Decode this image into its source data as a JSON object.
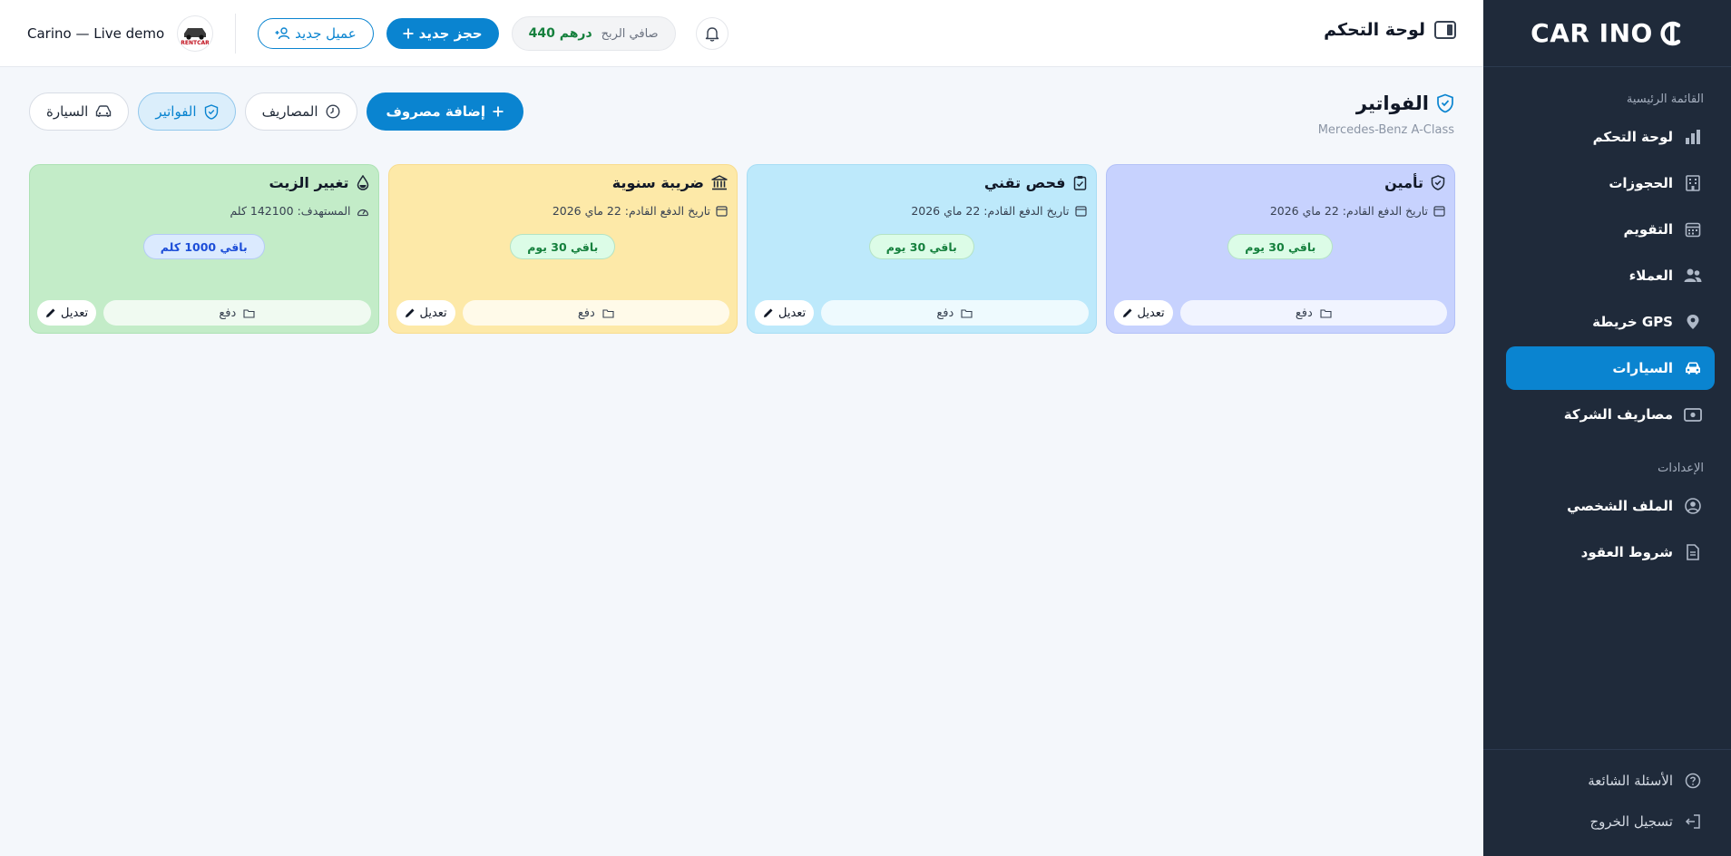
{
  "header": {
    "title": "لوحة التحكم",
    "demo_name": "Carino — Live demo",
    "avatar_text": "RENTCAR",
    "new_client_label": "عميل جديد",
    "new_booking_label": "حجز جديد",
    "profit_label": "صافي الربح",
    "profit_value": "440 درهم"
  },
  "sidebar": {
    "logo_text": "CAR INO",
    "main_section_label": "القائمة الرئيسية",
    "main_items": [
      {
        "label": "لوحة التحكم",
        "icon": "bar-chart-icon"
      },
      {
        "label": "الحجوزات",
        "icon": "building-icon"
      },
      {
        "label": "التقويم",
        "icon": "calendar-icon"
      },
      {
        "label": "العملاء",
        "icon": "users-icon"
      },
      {
        "label": "خريطة GPS",
        "icon": "map-pin-icon"
      },
      {
        "label": "السيارات",
        "icon": "car-icon",
        "active": true
      },
      {
        "label": "مصاريف الشركة",
        "icon": "wallet-icon"
      }
    ],
    "settings_section_label": "الإعدادات",
    "settings_items": [
      {
        "label": "الملف الشخصي",
        "icon": "user-circle-icon"
      },
      {
        "label": "شروط العقود",
        "icon": "document-icon"
      }
    ],
    "bottom_items": [
      {
        "label": "الأسئلة الشائعة",
        "icon": "help-icon"
      },
      {
        "label": "تسجيل الخروج",
        "icon": "logout-icon"
      }
    ]
  },
  "page": {
    "title": "الفواتير",
    "subtitle": "Mercedes-Benz A-Class",
    "add_expense_label": "إضافة مصروف",
    "tabs": [
      {
        "label": "المصاريف",
        "icon": "clock-icon"
      },
      {
        "label": "الفواتير",
        "icon": "shield-icon",
        "active": true
      },
      {
        "label": "السيارة",
        "icon": "car-icon"
      }
    ]
  },
  "cards": [
    {
      "title": "تأمين",
      "icon": "shield-icon",
      "line": "تاريخ الدفع القادم: 22 ماي 2026",
      "line_icon": "calendar-icon",
      "badge": "باقي 30 يوم",
      "pay_label": "دفع",
      "edit_label": "تعديل",
      "bg": "#c7d2fe",
      "border": "#b3c1f7",
      "badge_bg": "#dcfce7",
      "badge_color": "#15803d"
    },
    {
      "title": "فحص تقني",
      "icon": "clipboard-icon",
      "line": "تاريخ الدفع القادم: 22 ماي 2026",
      "line_icon": "calendar-icon",
      "badge": "باقي 30 يوم",
      "pay_label": "دفع",
      "edit_label": "تعديل",
      "bg": "#bde9fb",
      "border": "#a7ddf4",
      "badge_bg": "#dcfce7",
      "badge_color": "#15803d"
    },
    {
      "title": "ضريبة سنوية",
      "icon": "bank-icon",
      "line": "تاريخ الدفع القادم: 22 ماي 2026",
      "line_icon": "calendar-icon",
      "badge": "باقي 30 يوم",
      "pay_label": "دفع",
      "edit_label": "تعديل",
      "bg": "#fde9a8",
      "border": "#f8dc8e",
      "badge_bg": "#dcfce7",
      "badge_color": "#15803d"
    },
    {
      "title": "تغيير الزيت",
      "icon": "drop-icon",
      "line": "المستهدف: 142100 كلم",
      "line_icon": "gauge-icon",
      "badge": "باقي 1000 كلم",
      "pay_label": "دفع",
      "edit_label": "تعديل",
      "bg": "#c3ecc8",
      "border": "#ade2b4",
      "badge_bg": "#dbeafe",
      "badge_color": "#1d4ed8"
    }
  ]
}
